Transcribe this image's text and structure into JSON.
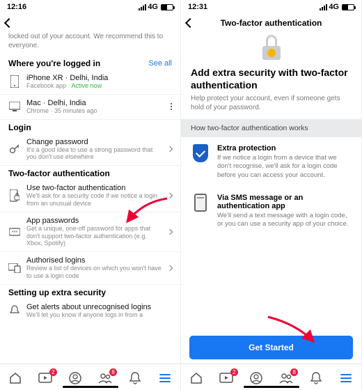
{
  "left": {
    "status_time": "12:16",
    "net": "4G",
    "snippet": "locked out of your account. We recommend this to everyone.",
    "where_hdr": "Where you're logged in",
    "see_all": "See all",
    "dev1_title": "iPhone XR · Delhi, India",
    "dev1_sub_a": "Facebook app · ",
    "dev1_sub_b": "Active now",
    "dev2_title": "Mac · Delhi, India",
    "dev2_sub": "Chrome · 35 minutes ago",
    "login_hdr": "Login",
    "cp_title": "Change password",
    "cp_sub": "It's a good idea to use a strong password that you don't use elsewhere",
    "tfa_hdr": "Two-factor authentication",
    "u2fa_title": "Use two-factor authentication",
    "u2fa_sub": "We'll ask for a security code if we notice a login from an unusual device",
    "ap_title": "App passwords",
    "ap_sub": "Get a unique, one-off password for apps that don't support two-factor authentication (e.g. Xbox, Spotify)",
    "al_title": "Authorised logins",
    "al_sub": "Review a list of devices on which you won't have to use a login code",
    "extra_hdr": "Setting up extra security",
    "ga_title": "Get alerts about unrecognised logins",
    "ga_sub": "We'll let you know if anyone logs in from a",
    "badge2": "2",
    "badge8": "8"
  },
  "right": {
    "status_time": "12:31",
    "net": "4G",
    "page_title": "Two-factor authentication",
    "heading": "Add extra security with two-factor authentication",
    "subheading": "Help protect your account, even if someone gets hold of your password.",
    "how": "How two-factor authentication works",
    "ep_title": "Extra protection",
    "ep_desc": "If we notice a login from a device that we don't recognise, we'll ask for a login code before you can access your account.",
    "sms_title": "Via SMS message or an authentication app",
    "sms_desc": "We'll send a text message with a login code, or you can use a security app of your choice.",
    "cta": "Get Started",
    "badge2": "2",
    "badge8": "8"
  }
}
